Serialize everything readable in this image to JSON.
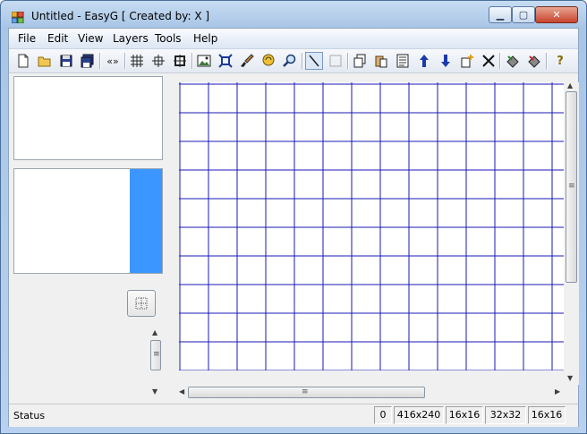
{
  "window": {
    "title": "Untitled - EasyG [ Created by: X ]",
    "min_glyph": "▁",
    "max_glyph": "▢",
    "close_glyph": "✕"
  },
  "menu": [
    "File",
    "Edit",
    "View",
    "Layers",
    "Tools",
    "Help"
  ],
  "toolbar": {
    "icons": [
      "new-file",
      "open-folder",
      "save",
      "save-all",
      "swap-arrows",
      "grid",
      "crosshair",
      "frame",
      "image",
      "fit",
      "brush",
      "lasso",
      "zoom",
      "line",
      "rectangle",
      "copy",
      "paste",
      "text",
      "move-up",
      "move-down",
      "add-layer",
      "delete",
      "bucket-a",
      "bucket-b",
      "help"
    ],
    "swap_glyph": "«»",
    "help_glyph": "?"
  },
  "palette": {
    "swatch_color": "#3b96ff"
  },
  "canvas": {
    "grid_color": "#1a1ab5"
  },
  "scroll": {
    "grip": "≡",
    "up": "▲",
    "down": "▼",
    "left": "◀",
    "right": "▶"
  },
  "status": {
    "label": "Status",
    "cells": [
      "0",
      "416x240",
      "16x16",
      "32x32",
      "16x16"
    ]
  }
}
